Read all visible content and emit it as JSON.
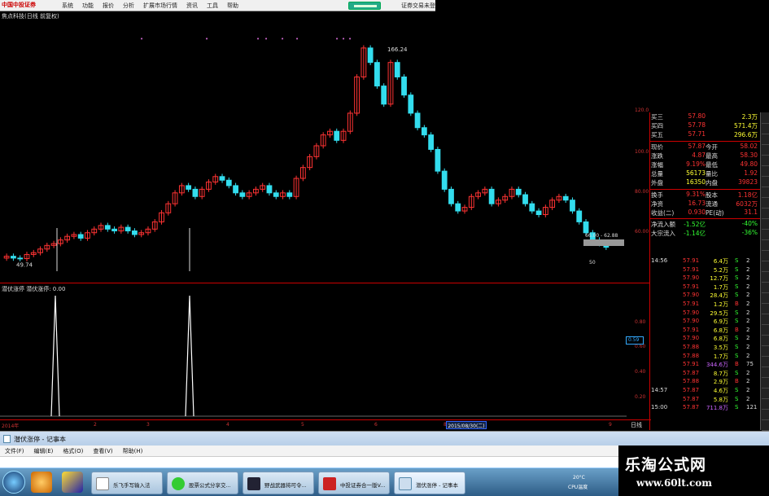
{
  "app": {
    "logo": "中国中投证券",
    "menu": [
      "系统",
      "功能",
      "报价",
      "分析",
      "扩展市场行情",
      "资讯",
      "工具",
      "帮助"
    ],
    "trade_link": "证券交易未登"
  },
  "chart": {
    "title": "焦点科技(日线 前复权)",
    "high_label": "166.24",
    "low_label": "49.74",
    "range_label": "66.00 - 62.88",
    "low2_label": "50",
    "indicator_title": "潜伏涨停  潜伏涨停: 0.00",
    "highlight_value": "0.59",
    "date_box": "2015/08/30(二)",
    "period_label": "日线"
  },
  "chart_data": {
    "type": "candlestick",
    "y_ticks_main": [
      "120.0",
      "100.0",
      "80.00",
      "60.00"
    ],
    "y_ticks_indicator": [
      "0.80",
      "0.60",
      "0.40",
      "0.20"
    ],
    "x_labels": [
      "2014年",
      "2",
      "3",
      "4",
      "5",
      "6",
      "8",
      "9"
    ],
    "ylim_main": [
      45,
      170
    ],
    "closes": [
      51,
      50,
      49.7,
      52,
      53,
      55,
      57,
      58,
      60,
      62,
      63,
      61,
      64,
      66,
      68,
      66,
      65,
      67,
      65,
      63,
      64,
      66,
      70,
      75,
      80,
      86,
      90,
      88,
      84,
      88,
      92,
      95,
      93,
      90,
      86,
      84,
      86,
      88,
      90,
      86,
      84,
      86,
      84,
      94,
      100,
      106,
      112,
      118,
      120,
      115,
      120,
      130,
      150,
      166,
      158,
      145,
      135,
      158,
      150,
      140,
      130,
      122,
      118,
      110,
      98,
      88,
      80,
      76,
      78,
      84,
      86,
      88,
      80,
      82,
      84,
      88,
      85,
      80,
      76,
      74,
      78,
      82,
      84,
      82,
      76,
      70,
      64,
      60,
      58,
      56
    ],
    "signal_spikes": [
      {
        "index": 11,
        "value": 1.0
      },
      {
        "index": 38,
        "value": 1.0
      }
    ]
  },
  "quote": {
    "rows": [
      {
        "l": "买三",
        "v": "57.80",
        "l2": "",
        "v2": "2.3万"
      },
      {
        "l": "买四",
        "v": "57.78",
        "l2": "",
        "v2": "571.4万"
      },
      {
        "l": "买五",
        "v": "57.71",
        "l2": "",
        "v2": "296.6万"
      },
      {
        "l": "现价",
        "v": "57.87",
        "l2": "今开",
        "v2": "58.02"
      },
      {
        "l": "涨跌",
        "v": "4.87",
        "l2": "最高",
        "v2": "58.30"
      },
      {
        "l": "涨幅",
        "v": "9.19%",
        "l2": "最低",
        "v2": "49.80"
      },
      {
        "l": "总量",
        "v": "56173",
        "l2": "量比",
        "v2": "1.92"
      },
      {
        "l": "外盘",
        "v": "16350",
        "l2": "内盘",
        "v2": "39823"
      },
      {
        "l": "换手",
        "v": "9.31%",
        "l2": "股本",
        "v2": "1.18亿"
      },
      {
        "l": "净资",
        "v": "16.73",
        "l2": "流通",
        "v2": "6032万"
      },
      {
        "l": "收益(二)",
        "v": "0.930",
        "l2": "PE(动)",
        "v2": "31.1"
      },
      {
        "l": "净流入额",
        "v": "-1.52亿",
        "l2": "",
        "v2": "-40%"
      },
      {
        "l": "大宗流入",
        "v": "-1.14亿",
        "l2": "",
        "v2": "-36%"
      }
    ]
  },
  "ticks": [
    {
      "t": "14:56",
      "p": "57.91",
      "vol": "6.4万",
      "s": "S",
      "n": "2"
    },
    {
      "t": "",
      "p": "57.91",
      "vol": "5.2万",
      "s": "S",
      "n": "2"
    },
    {
      "t": "",
      "p": "57.90",
      "vol": "12.7万",
      "s": "S",
      "n": "2"
    },
    {
      "t": "",
      "p": "57.91",
      "vol": "1.7万",
      "s": "S",
      "n": "2"
    },
    {
      "t": "",
      "p": "57.90",
      "vol": "28.4万",
      "s": "S",
      "n": "2"
    },
    {
      "t": "",
      "p": "57.91",
      "vol": "1.2万",
      "s": "B",
      "n": "2"
    },
    {
      "t": "",
      "p": "57.90",
      "vol": "29.5万",
      "s": "S",
      "n": "2"
    },
    {
      "t": "",
      "p": "57.90",
      "vol": "6.9万",
      "s": "S",
      "n": "2"
    },
    {
      "t": "",
      "p": "57.91",
      "vol": "6.8万",
      "s": "B",
      "n": "2"
    },
    {
      "t": "",
      "p": "57.90",
      "vol": "6.8万",
      "s": "S",
      "n": "2"
    },
    {
      "t": "",
      "p": "57.88",
      "vol": "3.5万",
      "s": "S",
      "n": "2"
    },
    {
      "t": "",
      "p": "57.88",
      "vol": "1.7万",
      "s": "S",
      "n": "2"
    },
    {
      "t": "",
      "p": "57.91",
      "vol": "344.6万",
      "s": "B",
      "n": "75"
    },
    {
      "t": "",
      "p": "57.87",
      "vol": "8.7万",
      "s": "S",
      "n": "2"
    },
    {
      "t": "",
      "p": "57.88",
      "vol": "2.9万",
      "s": "B",
      "n": "2"
    },
    {
      "t": "14:57",
      "p": "57.87",
      "vol": "4.6万",
      "s": "S",
      "n": "2"
    },
    {
      "t": "",
      "p": "57.87",
      "vol": "5.8万",
      "s": "S",
      "n": "2"
    },
    {
      "t": "15:00",
      "p": "57.87",
      "vol": "711.8万",
      "s": "S",
      "n": "121"
    }
  ],
  "notepad": {
    "title": "潜伏涨停 - 记事本",
    "menu": [
      "文件(F)",
      "编辑(E)",
      "格式(O)",
      "查看(V)",
      "帮助(H)"
    ]
  },
  "taskbar": {
    "buttons": [
      "乐飞手写输入法",
      "股票公式分享交...",
      "野战武器将可令...",
      "中投证券合一版V...",
      "潜伏涨停 - 记事本"
    ],
    "temp": "20°C",
    "cpu": "CPU温度"
  },
  "watermark": {
    "line1": "乐淘公式网",
    "line2": "www.60lt.com"
  },
  "colors": {
    "up": "#ff3333",
    "down": "#33ddee",
    "grid": "#cc0000",
    "signal": "#ffffff"
  }
}
